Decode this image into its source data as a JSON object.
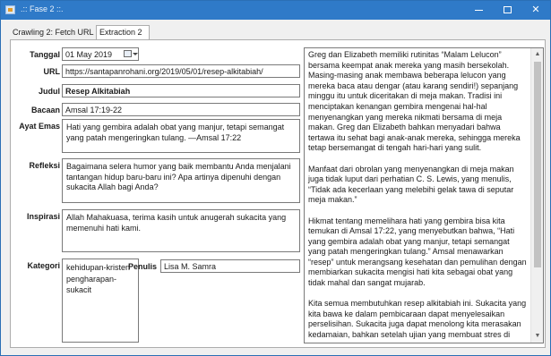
{
  "window": {
    "title": ".:: Fase 2 ::."
  },
  "tabs": [
    {
      "label": "Crawling 2: Fetch URL"
    },
    {
      "label": "Extraction 2"
    }
  ],
  "form": {
    "tanggal": {
      "label": "Tanggal",
      "value": "01 May 2019"
    },
    "url": {
      "label": "URL",
      "value": "https://santapanrohani.org/2019/05/01/resep-alkitabiah/"
    },
    "judul": {
      "label": "Judul",
      "value": "Resep Alkitabiah"
    },
    "bacaan": {
      "label": "Bacaan",
      "value": "Amsal 17:19-22"
    },
    "ayat_emas": {
      "label": "Ayat Emas",
      "value": "Hati yang gembira adalah obat yang manjur, tetapi semangat yang patah mengeringkan tulang. —Amsal 17:22"
    },
    "refleksi": {
      "label": "Refleksi",
      "value": "Bagaimana selera humor yang baik membantu Anda menjalani tantangan hidup baru-baru ini? Apa artinya dipenuhi dengan sukacita Allah bagi Anda?"
    },
    "inspirasi": {
      "label": "Inspirasi",
      "value": "Allah Mahakuasa, terima kasih untuk anugerah sukacita yang memenuhi hati kami."
    },
    "kategori": {
      "label": "Kategori",
      "values": [
        "kehidupan-kristen",
        "pengharapan-sukacit"
      ]
    },
    "penulis": {
      "label": "Penulis",
      "value": "Lisa M. Samra"
    }
  },
  "article": {
    "paragraphs": [
      "Greg dan Elizabeth memiliki rutinitas “Malam Lelucon” bersama keempat anak mereka yang masih bersekolah. Masing-masing anak membawa beberapa lelucon yang mereka baca atau dengar (atau karang sendiri!) sepanjang minggu itu untuk diceritakan di meja makan. Tradisi ini menciptakan kenangan gembira mengenai hal-hal menyenangkan yang mereka nikmati bersama di meja makan. Greg dan Elizabeth bahkan menyadari bahwa tertawa itu sehat bagi anak-anak mereka, sehingga mereka tetap bersemangat di tengah hari-hari yang sulit.",
      "Manfaat dari obrolan yang menyenangkan di meja makan juga tidak luput dari perhatian C. S. Lewis, yang menulis, “Tidak ada kecerlaan yang melebihi gelak tawa di seputar meja makan.”",
      "Hikmat tentang memelihara hati yang gembira bisa kita temukan di Amsal 17:22, yang menyebutkan bahwa, “Hati yang gembira adalah obat yang manjur, tetapi semangat yang patah mengeringkan tulang.” Amsal menawarkan “resep” untuk merangsang kesehatan dan pemulihan dengan membiarkan sukacita mengisi hati kita sebagai obat yang tidak mahal dan sangat mujarab.",
      "Kita semua membutuhkan resep alkitabiah ini. Sukacita yang kita bawa ke dalam pembicaraan dapat menyelesaikan perselisihan. Sukacita juga dapat menolong kita merasakan kedamaian, bahkan setelah ujian yang membuat stres di"
    ]
  },
  "colors": {
    "titlebar": "#2f7ac8",
    "window_bg": "#f0f0f0"
  }
}
